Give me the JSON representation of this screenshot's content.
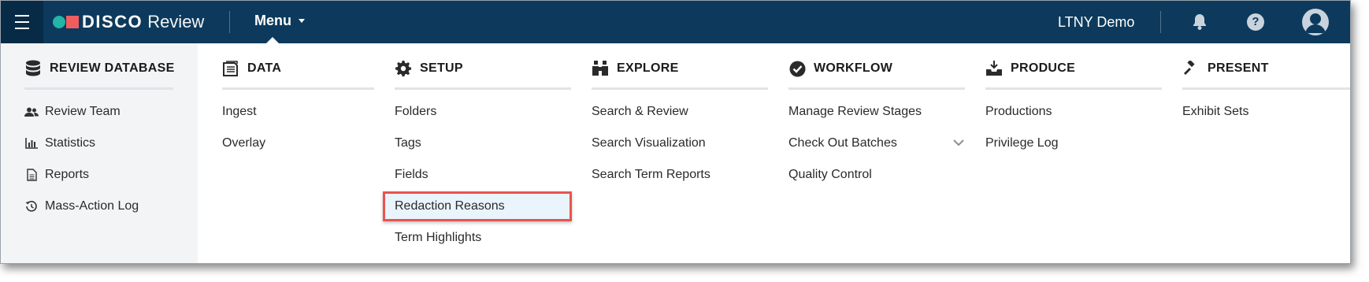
{
  "topbar": {
    "brand": "DISCO",
    "product": "Review",
    "menu_label": "Menu",
    "tenant": "LTNY Demo",
    "help_glyph": "?"
  },
  "colors": {
    "topbar_bg": "#0d3a5c",
    "logo_teal": "#23b5a6",
    "logo_red": "#f05d5e",
    "highlight_border": "#e8544f",
    "left_panel_bg": "#f3f4f5"
  },
  "columns": {
    "review_database": {
      "title": "REVIEW DATABASE",
      "icon": "database-icon",
      "items": [
        {
          "label": "Review Team",
          "icon": "users-icon"
        },
        {
          "label": "Statistics",
          "icon": "bar-chart-icon"
        },
        {
          "label": "Reports",
          "icon": "document-icon"
        },
        {
          "label": "Mass-Action Log",
          "icon": "history-icon"
        }
      ]
    },
    "data": {
      "title": "DATA",
      "icon": "documents-stack-icon",
      "items": [
        "Ingest",
        "Overlay"
      ]
    },
    "setup": {
      "title": "SETUP",
      "icon": "gear-icon",
      "items": [
        "Folders",
        "Tags",
        "Fields",
        "Redaction Reasons",
        "Term Highlights"
      ],
      "selected": "Redaction Reasons"
    },
    "explore": {
      "title": "EXPLORE",
      "icon": "binoculars-icon",
      "items": [
        "Search & Review",
        "Search Visualization",
        "Search Term Reports"
      ]
    },
    "workflow": {
      "title": "WORKFLOW",
      "icon": "check-circle-icon",
      "items": [
        "Manage Review Stages",
        "Check Out Batches",
        "Quality Control"
      ]
    },
    "produce": {
      "title": "PRODUCE",
      "icon": "inbox-download-icon",
      "items": [
        "Productions",
        "Privilege Log"
      ]
    },
    "present": {
      "title": "PRESENT",
      "icon": "gavel-icon",
      "items": [
        "Exhibit Sets"
      ]
    }
  }
}
